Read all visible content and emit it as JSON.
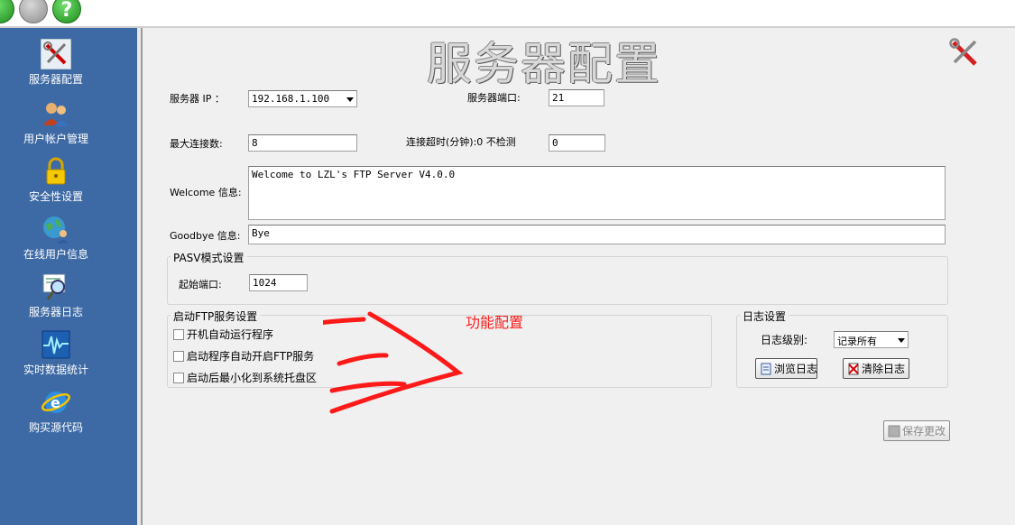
{
  "window": {
    "help_glyph": "?"
  },
  "sidebar": {
    "items": [
      {
        "label": "服务器配置",
        "icon": "tools-icon"
      },
      {
        "label": "用户帐户管理",
        "icon": "users-icon"
      },
      {
        "label": "安全性设置",
        "icon": "lock-icon"
      },
      {
        "label": "在线用户信息",
        "icon": "globe-user-icon"
      },
      {
        "label": "服务器日志",
        "icon": "log-magnifier-icon"
      },
      {
        "label": "实时数据统计",
        "icon": "pulse-chart-icon"
      },
      {
        "label": "购买源代码",
        "icon": "ie-globe-icon"
      }
    ]
  },
  "main": {
    "title": "服务器配置",
    "server_ip": {
      "label": "服务器 IP ：",
      "value": "192.168.1.100"
    },
    "server_port": {
      "label": "服务器端口:",
      "value": "21"
    },
    "max_connections": {
      "label": "最大连接数:",
      "value": "8"
    },
    "timeout": {
      "label": "连接超时(分钟):0 不检测",
      "value": "0"
    },
    "welcome": {
      "label": "Welcome 信息:",
      "value": "Welcome to LZL's FTP Server V4.0.0"
    },
    "goodbye": {
      "label": "Goodbye 信息:",
      "value": "Bye"
    },
    "pasv": {
      "group_title": "PASV模式设置",
      "start_port_label": "起始端口:",
      "start_port_value": "1024"
    },
    "startup": {
      "group_title": "启动FTP服务设置",
      "options": [
        {
          "label": "开机自动运行程序",
          "checked": false
        },
        {
          "label": "启动程序自动开启FTP服务",
          "checked": false
        },
        {
          "label": "启动后最小化到系统托盘区",
          "checked": false
        }
      ]
    },
    "log": {
      "group_title": "日志设置",
      "level_label": "日志级别:",
      "level_value": "记录所有",
      "browse_label": "浏览日志",
      "clear_label": "清除日志"
    },
    "save_label": "保存更改",
    "annotation": "功能配置"
  },
  "colors": {
    "sidebar_bg": "#3d6aa5",
    "panel_bg": "#f0f0f0",
    "annotation_red": "#ff1a1a"
  }
}
